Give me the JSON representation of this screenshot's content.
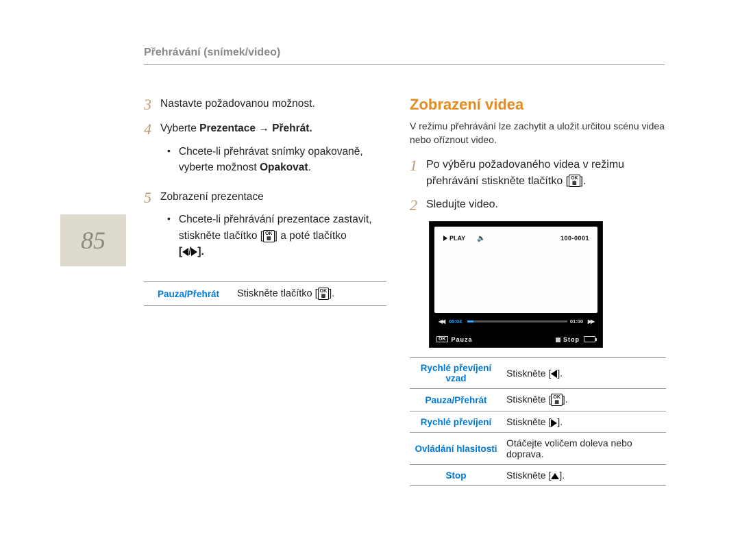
{
  "header": {
    "breadcrumb": "Přehrávání (snímek/video)"
  },
  "page_number": "85",
  "left": {
    "step3": {
      "text": "Nastavte požadovanou možnost."
    },
    "step4": {
      "line_pre": "Vyberte ",
      "line_bold": "Prezentace → Přehrát.",
      "bullet1_pre": "Chcete-li přehrávat snímky opakovaně, vyberte možnost ",
      "bullet1_bold": "Opakovat",
      "bullet1_post": "."
    },
    "step5": {
      "line": "Zobrazení prezentace",
      "bullet1_a": "Chcete-li přehrávání prezentace zastavit, stiskněte tlačítko [",
      "bullet1_b": "] a poté tlačítko",
      "bullet1_c": "[",
      "bullet1_d": "]."
    },
    "table": {
      "row1_label": "Pauza/Přehrát",
      "row1_val_a": "Stiskněte tlačítko [",
      "row1_val_b": "]."
    }
  },
  "right": {
    "title": "Zobrazení videa",
    "intro": "V režimu přehrávání lze zachytit a uložit určitou scénu videa nebo oříznout video.",
    "step1_a": "Po výběru požadovaného videa v režimu přehrávání stiskněte tlačítko [",
    "step1_b": "].",
    "step2": "Sledujte video.",
    "video": {
      "play_label": "PLAY",
      "counter": "100-0001",
      "time_cur": "00:04",
      "time_total": "01:00",
      "pause_label": "Pauza",
      "stop_label": "Stop",
      "ok": "OK"
    },
    "table": {
      "r1_label": "Rychlé převíjení vzad",
      "r1_val": "Stiskněte [",
      "r1_val_b": "].",
      "r2_label": "Pauza/Přehrát",
      "r2_val": "Stiskněte [",
      "r2_val_b": "].",
      "r3_label": "Rychlé převíjení",
      "r3_val": "Stiskněte [",
      "r3_val_b": "].",
      "r4_label": "Ovládání hlasitosti",
      "r4_val": "Otáčejte voličem doleva nebo doprava.",
      "r5_label": "Stop",
      "r5_val": "Stiskněte [",
      "r5_val_b": "]."
    }
  }
}
